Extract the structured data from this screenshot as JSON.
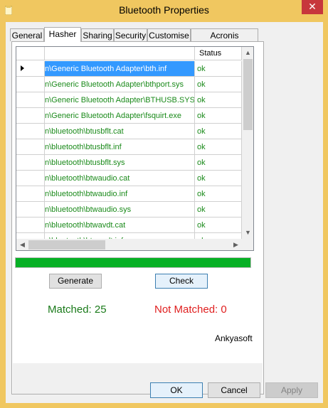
{
  "window": {
    "title": "Bluetooth Properties",
    "close_symbol": "✕"
  },
  "tabs": [
    {
      "label": "General"
    },
    {
      "label": "Hasher"
    },
    {
      "label": "Sharing"
    },
    {
      "label": "Security"
    },
    {
      "label": "Customise"
    },
    {
      "label": "Acronis Recovery"
    }
  ],
  "active_tab": "Hasher",
  "grid": {
    "columns": [
      "",
      "Status"
    ],
    "rows": [
      {
        "path": "n\\Generic Bluetooth Adapter\\bth.inf",
        "status": "ok"
      },
      {
        "path": "n\\Generic Bluetooth Adapter\\bthport.sys",
        "status": "ok"
      },
      {
        "path": "n\\Generic Bluetooth Adapter\\BTHUSB.SYS",
        "status": "ok"
      },
      {
        "path": "n\\Generic Bluetooth Adapter\\fsquirt.exe",
        "status": "ok"
      },
      {
        "path": "n\\bluetooth\\btusbflt.cat",
        "status": "ok"
      },
      {
        "path": "n\\bluetooth\\btusbflt.inf",
        "status": "ok"
      },
      {
        "path": "n\\bluetooth\\btusbflt.sys",
        "status": "ok"
      },
      {
        "path": "n\\bluetooth\\btwaudio.cat",
        "status": "ok"
      },
      {
        "path": "n\\bluetooth\\btwaudio.inf",
        "status": "ok"
      },
      {
        "path": "n\\bluetooth\\btwaudio.sys",
        "status": "ok"
      },
      {
        "path": "n\\bluetooth\\btwavdt.cat",
        "status": "ok"
      },
      {
        "path": "n\\bluetooth\\btwavdt.inf",
        "status": "ok"
      }
    ]
  },
  "progress": 1.0,
  "buttons": {
    "generate": "Generate",
    "check": "Check",
    "ok": "OK",
    "cancel": "Cancel",
    "apply": "Apply"
  },
  "results": {
    "matched": "Matched: 25",
    "not_matched": "Not Matched: 0"
  },
  "brand": "Ankyasoft",
  "colors": {
    "ok_green": "#1a8a1a",
    "not_matched_red": "#e02020",
    "progress_green": "#06b025",
    "selection_blue": "#3399ff",
    "frame": "#f0c760",
    "close_red": "#c7373c"
  }
}
